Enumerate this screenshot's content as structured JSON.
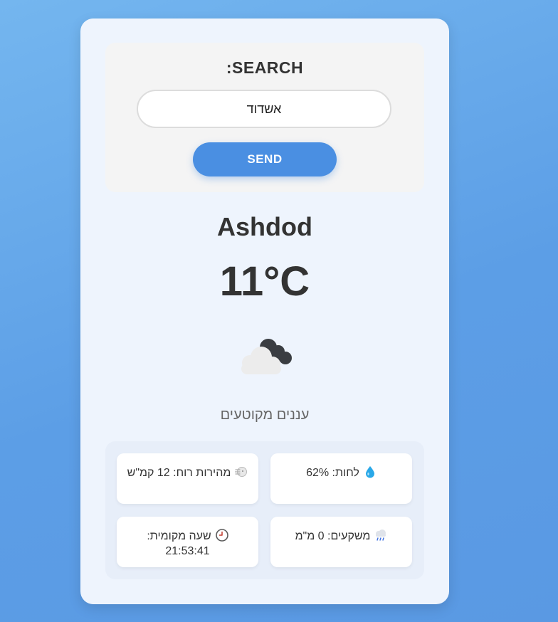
{
  "search": {
    "title": ":SEARCH",
    "value": "אשדוד",
    "button_label": "SEND"
  },
  "weather": {
    "city": "Ashdod",
    "temperature": "11°C",
    "icon": "partly-cloudy-dark-icon",
    "description": "עננים מקוטעים"
  },
  "details": {
    "humidity": {
      "icon": "droplet-icon",
      "text": "לחות: 62%"
    },
    "wind": {
      "icon": "wind-icon",
      "text": "מהירות רוח: 12 קמ\"ש"
    },
    "precipitation": {
      "icon": "rain-cloud-icon",
      "text": "משקעים: 0 מ\"מ"
    },
    "local_time": {
      "icon": "clock-icon",
      "text": "שעה מקומית: 21:53:41"
    }
  },
  "colors": {
    "background": "#6aaae9",
    "card": "#eef4fd",
    "accent": "#4a8fe2",
    "text": "#333333"
  }
}
